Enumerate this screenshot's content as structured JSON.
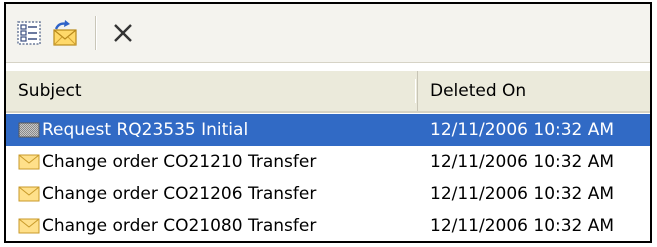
{
  "toolbar": {
    "buttons": [
      {
        "name": "categorize-icon"
      },
      {
        "name": "restore-mail-icon"
      },
      {
        "name": "delete-x-icon"
      }
    ]
  },
  "columns": {
    "subject": "Subject",
    "deleted_on": "Deleted On"
  },
  "rows": [
    {
      "icon": "request-icon",
      "subject": "Request RQ23535 Initial",
      "deleted_on": "12/11/2006 10:32 AM",
      "selected": true
    },
    {
      "icon": "envelope-icon",
      "subject": "Change order CO21210 Transfer",
      "deleted_on": "12/11/2006 10:32 AM",
      "selected": false
    },
    {
      "icon": "envelope-icon",
      "subject": "Change order CO21206 Transfer",
      "deleted_on": "12/11/2006 10:32 AM",
      "selected": false
    },
    {
      "icon": "envelope-icon",
      "subject": "Change order CO21080 Transfer",
      "deleted_on": "12/11/2006 10:32 AM",
      "selected": false
    }
  ],
  "colors": {
    "selection": "#316ac5",
    "header_bg": "#ebeadb",
    "toolbar_bg": "#f4f3ee"
  }
}
